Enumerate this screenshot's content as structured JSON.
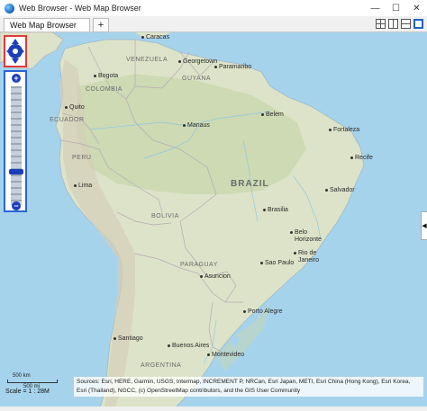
{
  "window": {
    "title": "Web Browser - Web Map Browser",
    "controls": {
      "minimize": "—",
      "maximize": "☐",
      "close": "✕"
    }
  },
  "tabs": [
    {
      "label": "Web Map Browser"
    }
  ],
  "tab_add_label": "+",
  "layout_buttons": [
    "grid-layout-icon",
    "split-vertical-icon",
    "split-horizontal-icon",
    "single-view-icon"
  ],
  "map": {
    "countries": {
      "venezuela": "VENEZUELA",
      "guyana": "GUYANA",
      "colombia": "COLOMBIA",
      "ecuador": "ECUADOR",
      "peru": "PERU",
      "brazil": "BRAZIL",
      "bolivia": "BOLIVIA",
      "paraguay": "PARAGUAY",
      "argentina": "ARGENTINA"
    },
    "cities": {
      "caracas": "Caracas",
      "georgetown": "Georgetown",
      "paramaribo": "Paramaribo",
      "bogota": "Bogota",
      "quito": "Quito",
      "manaus": "Manaus",
      "belem": "Belem",
      "fortaleza": "Fortaleza",
      "recife": "Recife",
      "lima": "Lima",
      "salvador": "Salvador",
      "brasilia": "Brasilia",
      "belo_horizonte_1": "Belo",
      "belo_horizonte_2": "Horizonte",
      "sao_paulo": "Sao Paulo",
      "rio_1": "Rio de",
      "rio_2": "Janeiro",
      "asuncion": "Asuncion",
      "porto_alegre": "Porto Alegre",
      "santiago": "Santiago",
      "buenos_aires_1": "Buenos Aires",
      "montevideo": "Montevideo"
    },
    "colors": {
      "ocean": "#a6d3ec",
      "land": "#dde3c8",
      "forest": "#c7d7ae",
      "border": "#b7a9b5"
    }
  },
  "scale": {
    "km_label": "500 km",
    "mi_label": "500 mi",
    "text": "Scale = 1 : 28M"
  },
  "attribution": "Sources: Esri, HERE, Garmin, USGS, Intermap, INCREMENT P, NRCan, Esri Japan, METI, Esri China (Hong Kong), Esri Korea, Esri (Thailand), NGCC, (c) OpenStreetMap contributors, and the GIS User Community"
}
